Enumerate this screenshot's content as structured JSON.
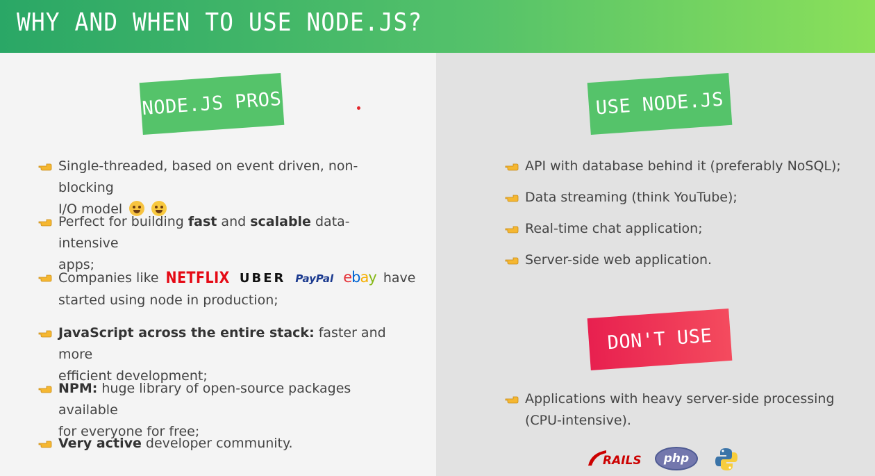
{
  "header": {
    "title": "WHY AND WHEN TO USE NODE.JS?"
  },
  "left": {
    "stamp": "NODE.JS PROS",
    "items": [
      {
        "line1": "Single-threaded, based on event driven, non-blocking",
        "line2": "I/O model"
      },
      {
        "pre": "Perfect for building ",
        "b1": "fast",
        "mid": " and ",
        "b2": "scalable",
        "post": " data-intensive",
        "line2": "apps;"
      },
      {
        "pre": "Companies like",
        "post": "have",
        "line2": "started using node in production;"
      },
      {
        "b1": "JavaScript across the entire stack:",
        "post": " faster and more",
        "line2": "efficient development;"
      },
      {
        "b1": "NPM:",
        "post": " huge library of open-source packages available",
        "line2": "for everyone for free;"
      },
      {
        "b1": "Very active",
        "post": " developer community."
      }
    ],
    "logos": {
      "netflix": "NETFLIX",
      "uber": "UBER",
      "paypal_a": "PayPal",
      "ebay": [
        "e",
        "b",
        "a",
        "y"
      ]
    }
  },
  "right": {
    "stamp_use": "USE NODE.JS",
    "use_items": [
      "API with database behind it (preferably NoSQL);",
      "Data streaming (think YouTube);",
      "Real-time chat application;",
      "Server-side web application."
    ],
    "stamp_dont": "DON'T USE",
    "dont_items": [
      {
        "line1": "Applications with heavy server-side processing",
        "line2": "(CPU-intensive)."
      }
    ],
    "logos": {
      "rails": "RAILS",
      "php": "php"
    }
  },
  "colors": {
    "green": "#55c36a",
    "red": "#e8204f",
    "bullet": "#f5b731"
  }
}
